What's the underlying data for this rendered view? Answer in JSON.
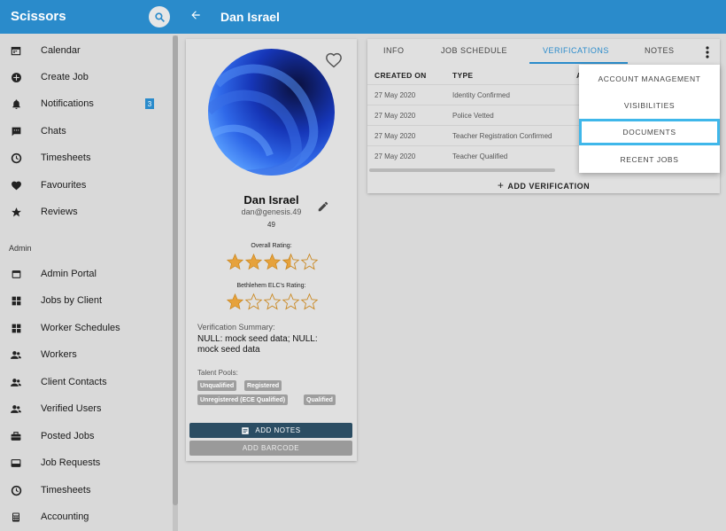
{
  "app": {
    "title": "Scissors"
  },
  "header": {
    "page_title": "Dan Israel"
  },
  "sidebar": {
    "items": [
      {
        "label": "Calendar",
        "icon": "calendar-icon"
      },
      {
        "label": "Create Job",
        "icon": "add-circle-icon"
      },
      {
        "label": "Notifications",
        "icon": "bell-icon",
        "badge": "3"
      },
      {
        "label": "Chats",
        "icon": "chat-icon"
      },
      {
        "label": "Timesheets",
        "icon": "clock-icon"
      },
      {
        "label": "Favourites",
        "icon": "heart-icon"
      },
      {
        "label": "Reviews",
        "icon": "star-icon"
      }
    ],
    "section_admin": "Admin",
    "admin_items": [
      {
        "label": "Admin Portal",
        "icon": "portal-icon"
      },
      {
        "label": "Jobs by Client",
        "icon": "grid-icon"
      },
      {
        "label": "Worker Schedules",
        "icon": "grid-icon"
      },
      {
        "label": "Workers",
        "icon": "people-icon"
      },
      {
        "label": "Client Contacts",
        "icon": "people-icon"
      },
      {
        "label": "Verified Users",
        "icon": "people-icon"
      },
      {
        "label": "Posted Jobs",
        "icon": "briefcase-icon"
      },
      {
        "label": "Job Requests",
        "icon": "inbox-icon"
      },
      {
        "label": "Timesheets",
        "icon": "clock-icon"
      },
      {
        "label": "Accounting",
        "icon": "calculator-icon"
      }
    ]
  },
  "profile": {
    "name": "Dan Israel",
    "email": "dan@genesis.49",
    "id": "49",
    "overall_rating_label": "Overall Rating:",
    "overall_rating": 3.5,
    "client_rating_label": "Bethlehem ELC's Rating:",
    "client_rating": 1,
    "verification_summary_label": "Verification Summary:",
    "verification_summary": "NULL: mock seed data; NULL: mock seed data",
    "talent_pools_label": "Talent Pools:",
    "talent_pools": [
      "Unqualified",
      "Registered",
      "Unregistered (ECE Qualified)",
      "Qualified"
    ],
    "add_notes_label": "ADD NOTES",
    "add_barcode_label": "ADD BARCODE"
  },
  "tabs": [
    {
      "label": "INFO"
    },
    {
      "label": "JOB SCHEDULE"
    },
    {
      "label": "VERIFICATIONS",
      "active": true
    },
    {
      "label": "NOTES"
    }
  ],
  "table": {
    "columns": [
      "CREATED ON",
      "TYPE",
      "A"
    ],
    "rows": [
      {
        "created_on": "27 May 2020",
        "type": "Identity Confirmed"
      },
      {
        "created_on": "27 May 2020",
        "type": "Police Vetted"
      },
      {
        "created_on": "27 May 2020",
        "type": "Teacher Registration Confirmed"
      },
      {
        "created_on": "27 May 2020",
        "type": "Teacher Qualified"
      }
    ],
    "add_label": "ADD VERIFICATION"
  },
  "menu": {
    "items": [
      {
        "label": "ACCOUNT MANAGEMENT"
      },
      {
        "label": "VISIBILITIES"
      },
      {
        "label": "DOCUMENTS",
        "focused": true
      },
      {
        "label": "RECENT JOBS"
      }
    ]
  },
  "colors": {
    "accent": "#2a8bcb",
    "star": "#e6a23c",
    "focus": "#3fb7ea"
  }
}
